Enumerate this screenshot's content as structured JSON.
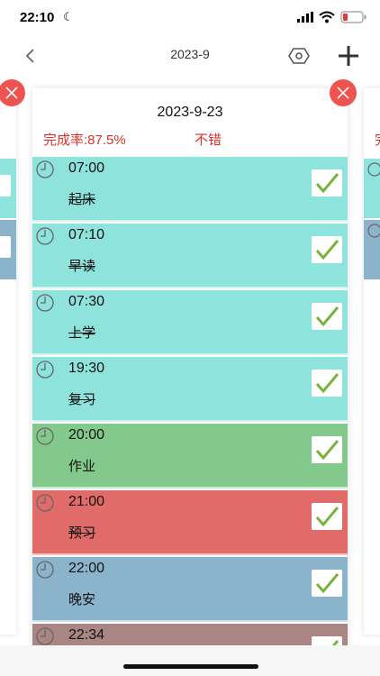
{
  "status_bar": {
    "time": "22:10"
  },
  "nav": {
    "title": "2023-9"
  },
  "card": {
    "date": "2023-9-23",
    "completion_rate": "完成率:87.5%",
    "comment": "不错"
  },
  "left_card": {
    "rows": [
      {
        "color": "#8ee3dc"
      },
      {
        "color": "#8bb3cc"
      }
    ]
  },
  "right_card": {
    "rate_fragment": "完",
    "rows": [
      {
        "color": "#8ee3dc"
      },
      {
        "color": "#8bb3cc"
      }
    ]
  },
  "tasks": [
    {
      "time": "07:00",
      "name": "起床",
      "color": "#8ee3dc",
      "strike": true
    },
    {
      "time": "07:10",
      "name": "早读",
      "color": "#8ee3dc",
      "strike": true
    },
    {
      "time": "07:30",
      "name": "上学",
      "color": "#8ee3dc",
      "strike": true
    },
    {
      "time": "19:30",
      "name": "复习",
      "color": "#8ee3dc",
      "strike": true
    },
    {
      "time": "20:00",
      "name": "作业",
      "color": "#84c98c",
      "strike": false
    },
    {
      "time": "21:00",
      "name": "预习",
      "color": "#e06b68",
      "strike": true
    },
    {
      "time": "22:00",
      "name": "晚安",
      "color": "#8bb3cc",
      "strike": false
    },
    {
      "time": "22:34",
      "name": "",
      "color": "#a98583",
      "strike": false
    }
  ],
  "icons": {
    "back": "chevron-left-icon",
    "settings": "hexagon-gear-icon",
    "add": "plus-icon",
    "clock": "clock-icon",
    "check": "checkmark-icon",
    "close": "close-icon"
  },
  "colors": {
    "accent_red": "#d9332b",
    "close_red": "#ef5350",
    "check_green": "#7ab33c"
  }
}
